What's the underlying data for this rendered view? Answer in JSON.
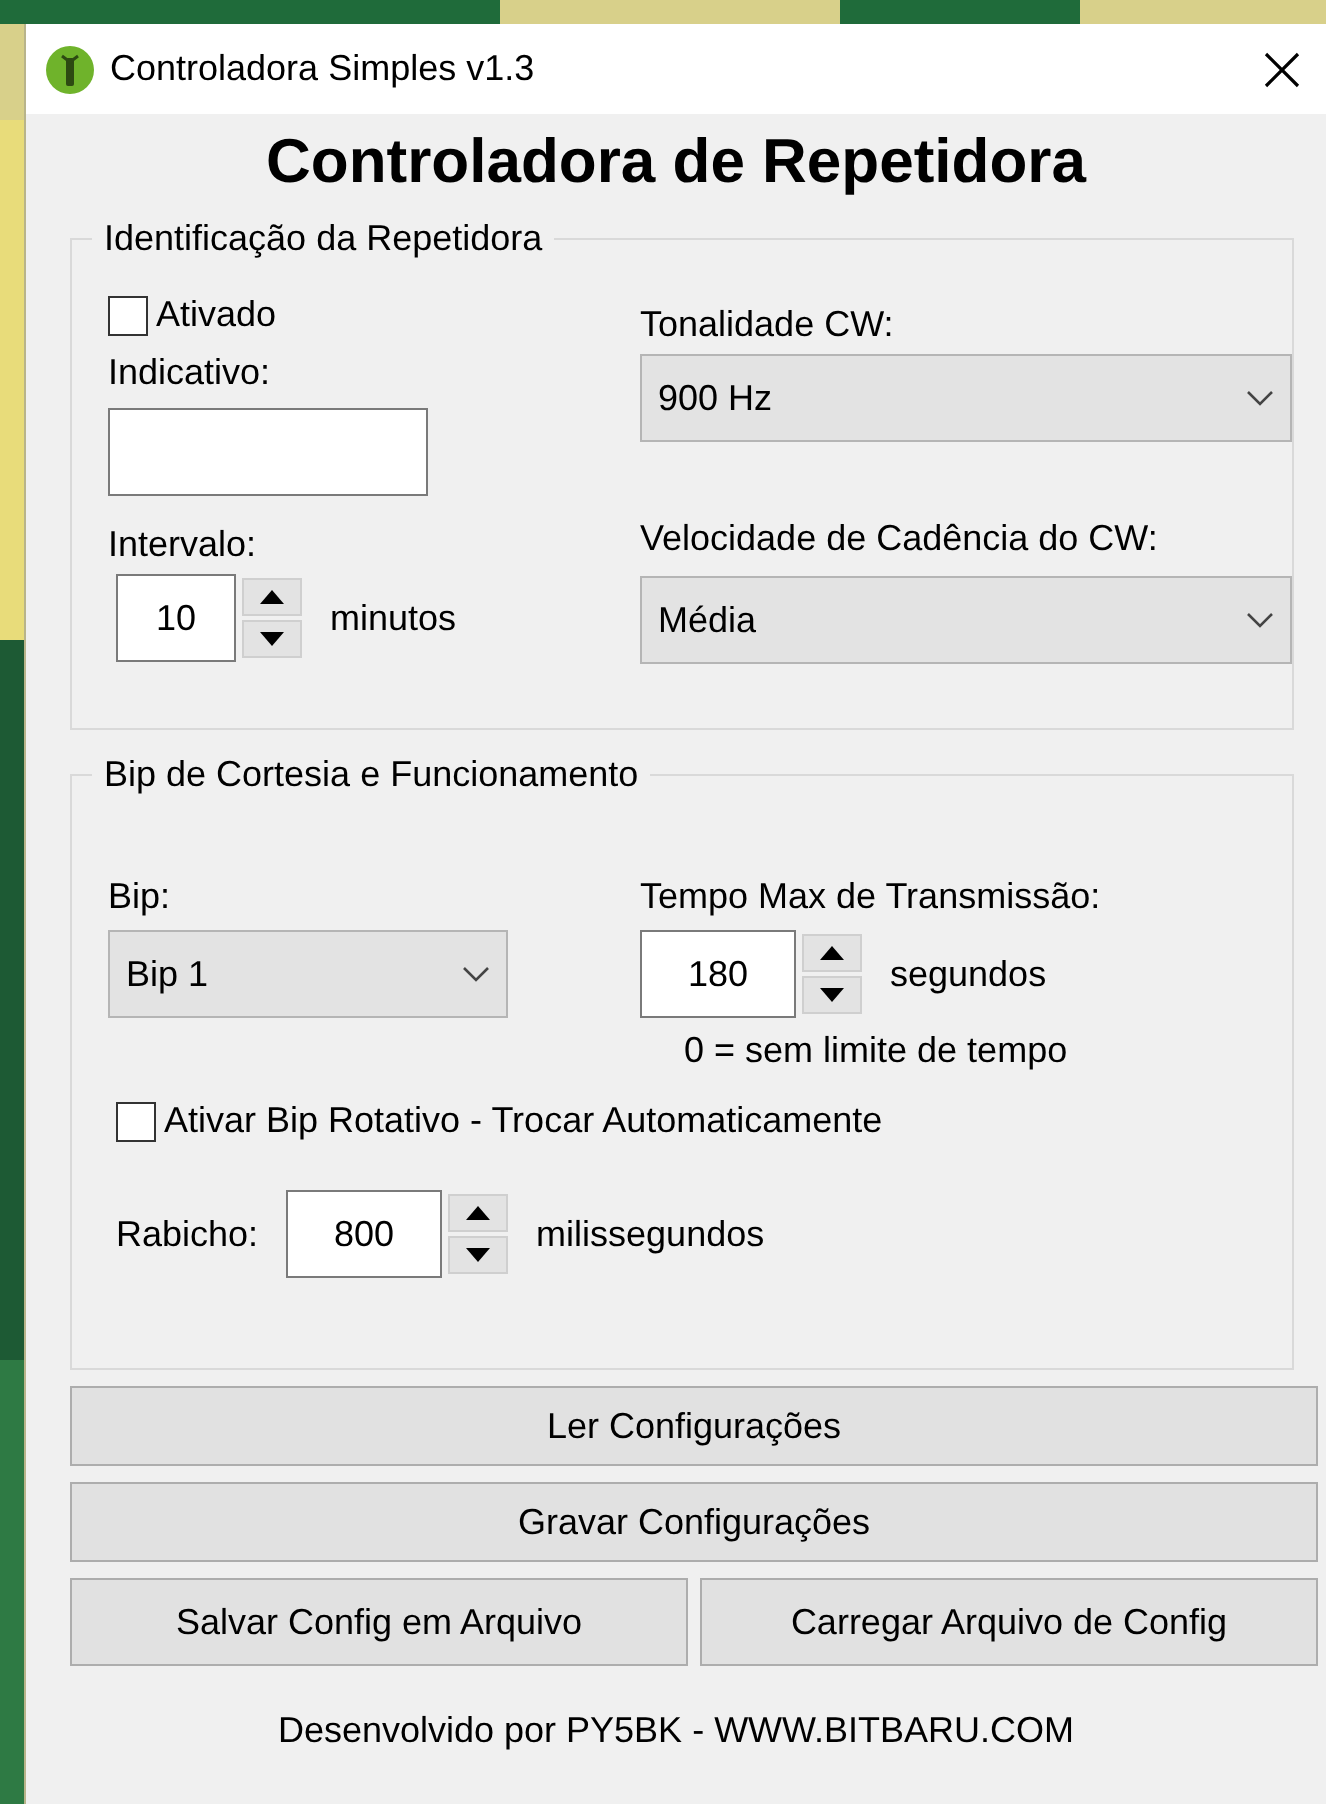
{
  "window": {
    "title": "Controladora Simples v1.3"
  },
  "heading": "Controladora de Repetidora",
  "identification": {
    "title": "Identificação da Repetidora",
    "enabled": {
      "label": "Ativado",
      "checked": false
    },
    "callsign": {
      "label": "Indicativo:"
    },
    "interval": {
      "label": "Intervalo:",
      "value": "10",
      "unit": "minutos"
    },
    "tone": {
      "label": "Tonalidade CW:",
      "value": "900 Hz"
    },
    "speed": {
      "label": "Velocidade de Cadência do CW:",
      "value": "Média"
    }
  },
  "courtesy": {
    "title": "Bip de Cortesia e Funcionamento",
    "beep": {
      "label": "Bip:",
      "value": "Bip 1"
    },
    "max_time": {
      "label": "Tempo Max de Transmissão:",
      "value": "180",
      "unit": "segundos",
      "note": "0 = sem limite de tempo"
    },
    "rotate": {
      "label": "Ativar Bip Rotativo - Trocar Automaticamente",
      "checked": false
    },
    "tail": {
      "label": "Rabicho:",
      "value": "800",
      "unit": "milissegundos"
    }
  },
  "buttons": [
    {
      "label": "Ler Configurações"
    },
    {
      "label": "Gravar Configurações"
    }
  ],
  "file_buttons": [
    {
      "label": "Salvar Config em Arquivo"
    },
    {
      "label": "Carregar Arquivo de Config"
    }
  ],
  "footer": "Desenvolvido por PY5BK - WWW.BITBARU.COM"
}
